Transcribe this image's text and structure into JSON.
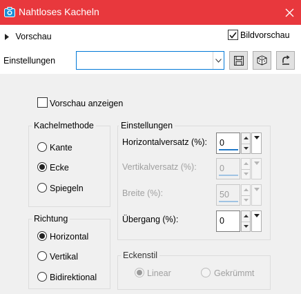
{
  "window": {
    "title": "Nahtloses Kacheln",
    "accent_color": "#e8383d",
    "icon": "camera-icon",
    "close_icon": "close-icon"
  },
  "preview": {
    "toggle_label": "Vorschau",
    "bildvorschau_label": "Bildvorschau",
    "bildvorschau_checked": true
  },
  "settings_bar": {
    "label": "Einstellungen",
    "combo_value": "",
    "buttons": [
      "save-icon",
      "cube-icon",
      "reset-icon"
    ]
  },
  "vorschau_anzeigen": {
    "label": "Vorschau anzeigen",
    "checked": false
  },
  "kachelmethode": {
    "title": "Kachelmethode",
    "options": [
      "Kante",
      "Ecke",
      "Spiegeln"
    ],
    "selected": "Ecke"
  },
  "richtung": {
    "title": "Richtung",
    "options": [
      "Horizontal",
      "Vertikal",
      "Bidirektional"
    ],
    "selected": "Horizontal"
  },
  "einstellungen": {
    "title": "Einstellungen",
    "fields": [
      {
        "label": "Horizontalversatz (%):",
        "value": "0",
        "enabled": true
      },
      {
        "label": "Vertikalversatz (%):",
        "value": "0",
        "enabled": false
      },
      {
        "label": "Breite (%):",
        "value": "50",
        "enabled": false
      },
      {
        "label": "Übergang (%):",
        "value": "0",
        "enabled": true
      }
    ]
  },
  "eckenstil": {
    "title": "Eckenstil",
    "options": [
      "Linear",
      "Gekrümmt"
    ],
    "selected": "Linear",
    "enabled": false
  }
}
